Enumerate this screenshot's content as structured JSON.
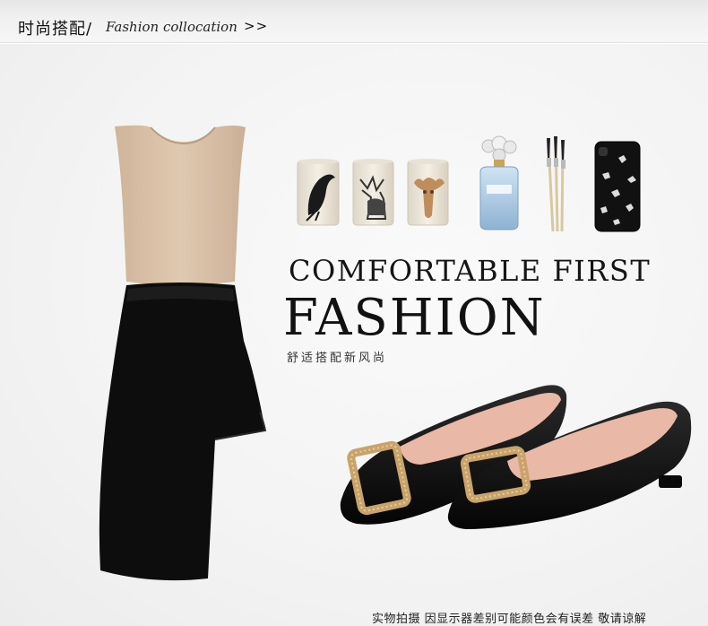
{
  "header": {
    "title_cn": "时尚搭配/",
    "title_en": "Fashion collocation",
    "more_arrows": ">>"
  },
  "banner": {
    "headline_line1": "COMFORTABLE FIRST",
    "headline_line2": "FASHION",
    "subtitle_cn": "舒适搭配新风尚"
  },
  "footer": {
    "disclaimer": "实物拍摄 因显示器差别可能颜色会有误差 敬请谅解"
  },
  "products": {
    "top_color": "#d9c1a8",
    "skirt_color": "#111111",
    "shoe_color": "#0f0f0f",
    "shoe_lining_color": "#e9b8a6",
    "buckle_color": "#c9a36a"
  },
  "icons": [
    "bird-cup-icon",
    "deer-cup-icon",
    "skull-cup-icon",
    "perfume-bottle-icon",
    "makeup-brushes-icon",
    "phone-case-icon"
  ]
}
